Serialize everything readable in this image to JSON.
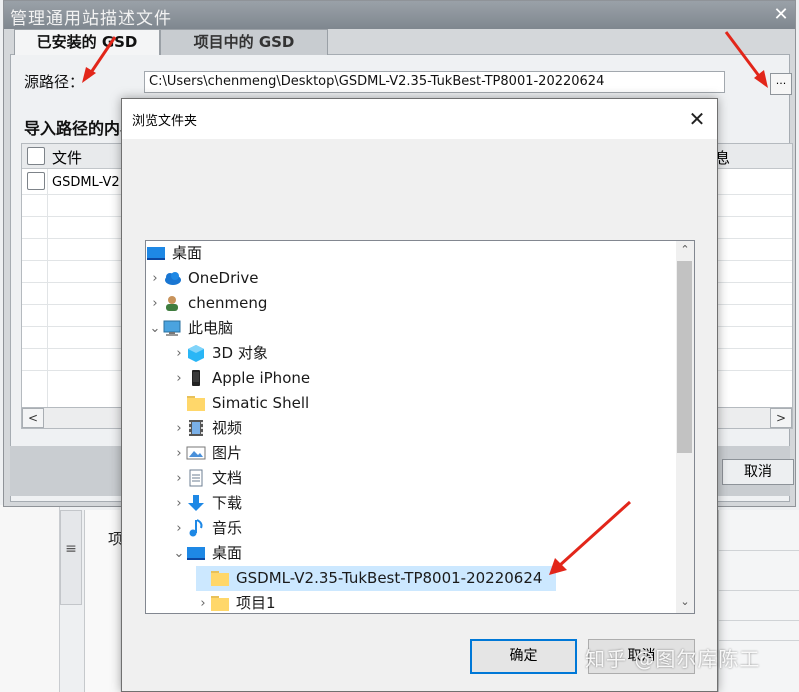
{
  "outer_dialog": {
    "title": "管理通用站描述文件",
    "tabs": [
      {
        "label": "已安装的 GSD"
      },
      {
        "label": "项目中的 GSD"
      }
    ],
    "source_label": "源路径：",
    "source_path": "C:\\Users\\chenmeng\\Desktop\\GSDML-V2.35-TukBest-TP8001-20220624",
    "browse_button_label": "...",
    "import_heading": "导入路径的内容",
    "table": {
      "columns": [
        "文件",
        "息"
      ],
      "rows": [
        "GSDML-V2"
      ]
    },
    "cancel_label": "取消"
  },
  "browse_dialog": {
    "title": "浏览文件夹",
    "tree": [
      {
        "label": "桌面",
        "icon": "desktop-icon"
      },
      {
        "label": "OneDrive",
        "icon": "onedrive-cloud-icon"
      },
      {
        "label": "chenmeng",
        "icon": "user-icon"
      },
      {
        "label": "此电脑",
        "icon": "computer-icon"
      },
      {
        "label": "3D 对象",
        "icon": "3d-objects-icon"
      },
      {
        "label": "Apple iPhone",
        "icon": "phone-icon"
      },
      {
        "label": "Simatic Shell",
        "icon": "folder-icon"
      },
      {
        "label": "视频",
        "icon": "video-icon"
      },
      {
        "label": "图片",
        "icon": "pictures-icon"
      },
      {
        "label": "文档",
        "icon": "documents-icon"
      },
      {
        "label": "下载",
        "icon": "download-icon"
      },
      {
        "label": "音乐",
        "icon": "music-icon"
      },
      {
        "label": "桌面",
        "icon": "desktop-icon"
      },
      {
        "label": "GSDML-V2.35-TukBest-TP8001-20220624",
        "icon": "folder-icon"
      },
      {
        "label": "项目1",
        "icon": "folder-icon"
      }
    ],
    "ok_label": "确定",
    "cancel_label": "取消"
  },
  "background": {
    "panel_text": "项"
  },
  "watermark": "知乎 @图尔库陈工",
  "colors": {
    "annotation_arrow": "#e2261a",
    "selection": "#cce8ff",
    "ok_border": "#0078d7"
  }
}
